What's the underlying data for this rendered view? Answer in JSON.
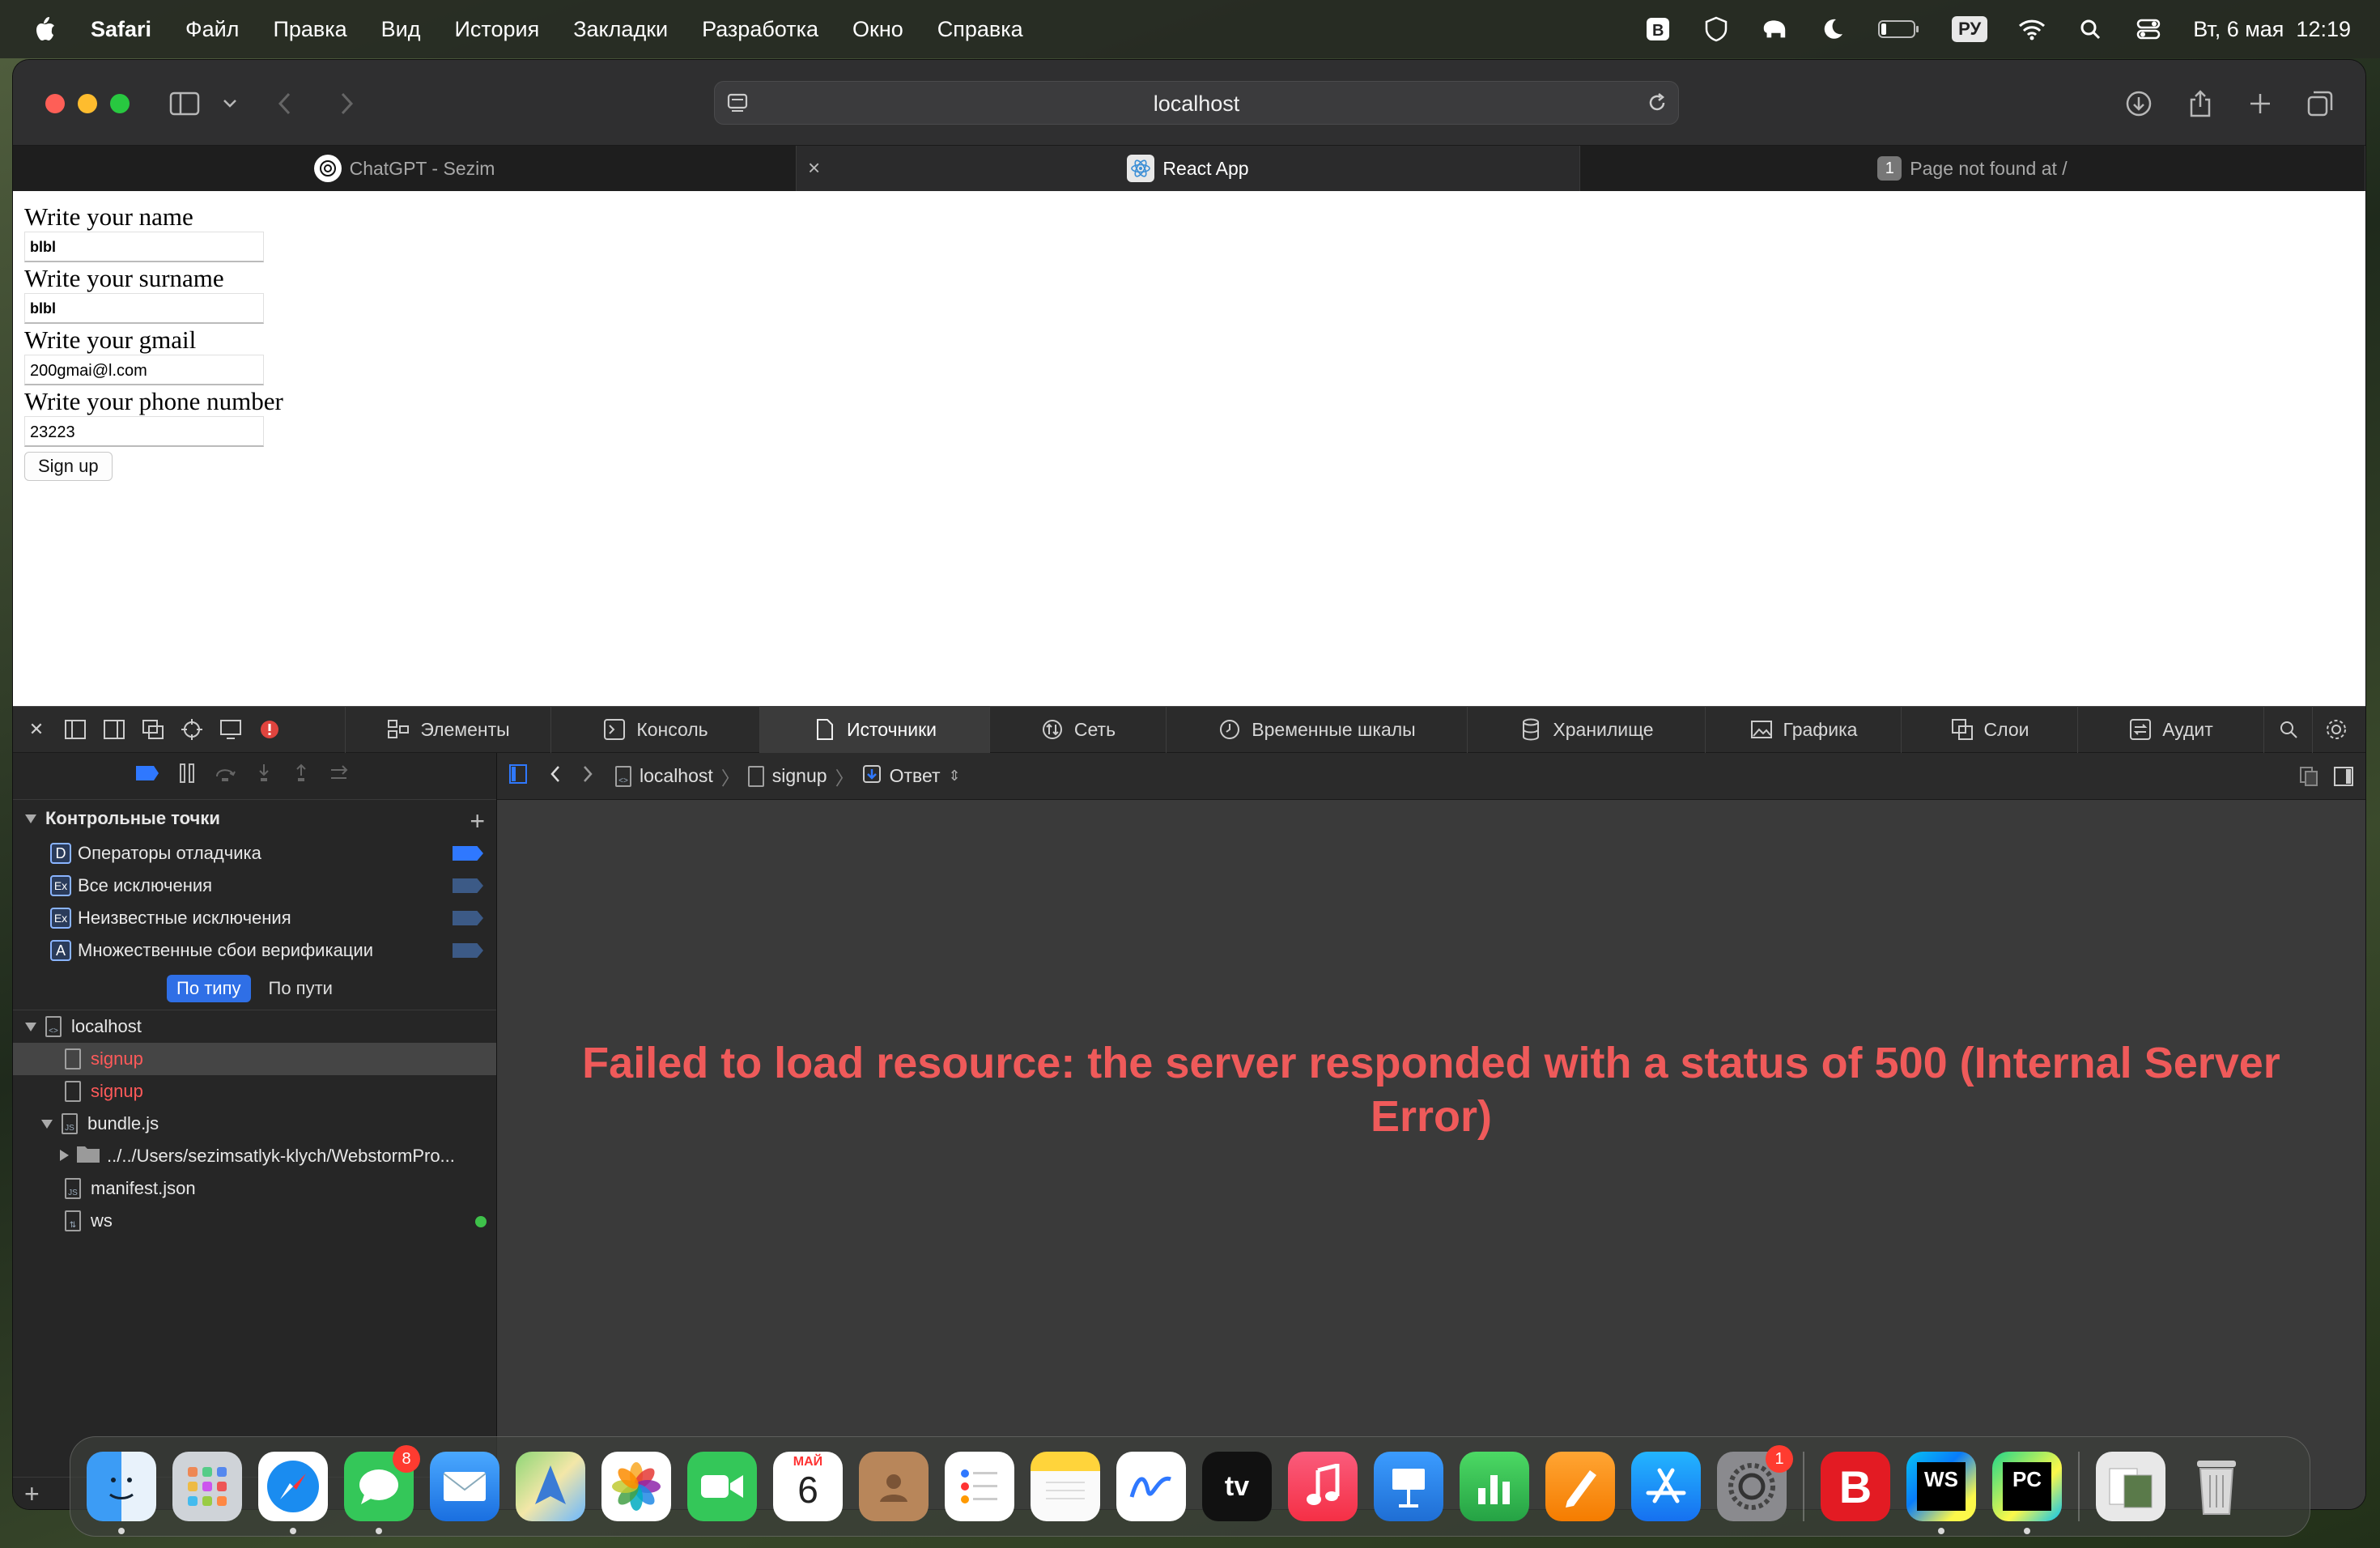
{
  "menubar": {
    "app": "Safari",
    "items": [
      "Файл",
      "Правка",
      "Вид",
      "История",
      "Закладки",
      "Разработка",
      "Окно",
      "Справка"
    ],
    "keyboard": "РУ",
    "datetime": "Вт, 6 мая  12:19"
  },
  "browser": {
    "url": "localhost",
    "tabs": [
      {
        "label": "ChatGPT - Sezim"
      },
      {
        "label": "React App"
      },
      {
        "label": "Page not found at /",
        "badge": "1"
      }
    ]
  },
  "form": {
    "name_label": "Write your name",
    "name_value": "blbl",
    "surname_label": "Write your surname",
    "surname_value": "blbl",
    "gmail_label": "Write your gmail",
    "gmail_value": "200gmai@l.com",
    "phone_label": "Write your phone number",
    "phone_value": "23223",
    "submit_label": "Sign up"
  },
  "devtools": {
    "tabs": [
      "Элементы",
      "Консоль",
      "Источники",
      "Сеть",
      "Временные шкалы",
      "Хранилище",
      "Графика",
      "Слои",
      "Аудит"
    ],
    "breakpoints_title": "Контрольные точки",
    "breakpoints": [
      {
        "badge": "D",
        "label": "Операторы отладчика"
      },
      {
        "badge": "Ex",
        "label": "Все исключения"
      },
      {
        "badge": "Ex",
        "label": "Неизвестные исключения"
      },
      {
        "badge": "A",
        "label": "Множественные сбои верификации"
      }
    ],
    "filter_by_type": "По типу",
    "filter_by_path": "По пути",
    "tree": {
      "root": "localhost",
      "signup_1": "signup",
      "signup_2": "signup",
      "bundle": "bundle.js",
      "folder": "../../Users/sezimsatlyk-klych/WebstormPro...",
      "manifest": "manifest.json",
      "ws": "ws"
    },
    "breadcrumb": {
      "host": "localhost",
      "resource": "signup",
      "mode": "Ответ"
    },
    "error_message": "Failed to load resource: the server responded with a status of 500 (Internal Server Error)"
  },
  "dock": {
    "messages_badge": "8",
    "calendar_month": "МАЙ",
    "calendar_day": "6",
    "settings_badge": "1",
    "tv_label": "tv",
    "webstorm_label": "WS",
    "pycharm_label": "PC"
  }
}
